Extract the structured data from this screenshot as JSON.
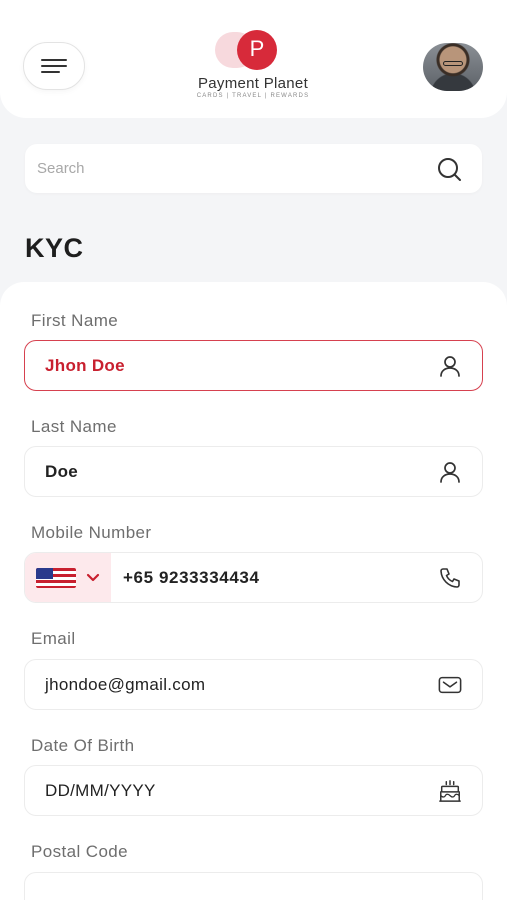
{
  "header": {
    "brand_initial": "P",
    "brand_name": "Payment Planet",
    "brand_tagline": "CARDS | TRAVEL | REWARDS"
  },
  "search": {
    "placeholder": "Search"
  },
  "page_title": "KYC",
  "form": {
    "first_name": {
      "label": "First Name",
      "value": "Jhon Doe",
      "icon": "user-icon"
    },
    "last_name": {
      "label": "Last Name",
      "value": "Doe",
      "icon": "user-icon"
    },
    "mobile": {
      "label": "Mobile Number",
      "country": "United States",
      "value": "+65  9233334434",
      "icon": "phone-icon"
    },
    "email": {
      "label": "Email",
      "value": "jhondoe@gmail.com",
      "icon": "mail-icon"
    },
    "dob": {
      "label": "Date Of Birth",
      "value": "DD/MM/YYYY",
      "icon": "cake-icon"
    },
    "postal": {
      "label": "Postal Code",
      "value": ""
    }
  },
  "colors": {
    "accent": "#d72a3a",
    "accent_light": "#fde9ec",
    "background": "#f4f5f7"
  }
}
